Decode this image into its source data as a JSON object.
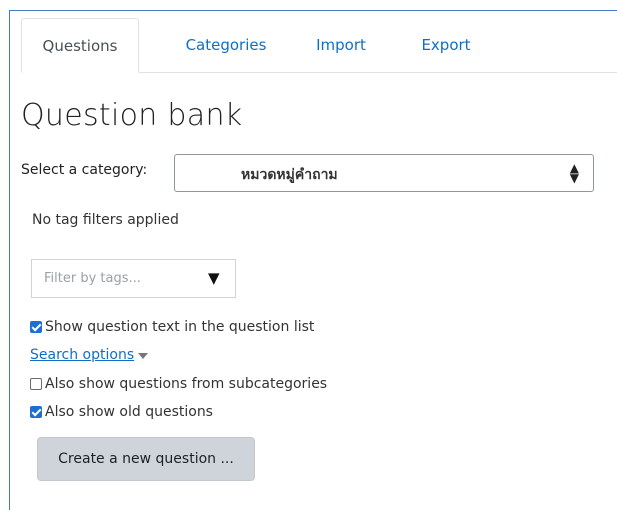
{
  "tabs": [
    {
      "label": "Questions",
      "active": true
    },
    {
      "label": "Categories",
      "active": false
    },
    {
      "label": "Import",
      "active": false
    },
    {
      "label": "Export",
      "active": false
    }
  ],
  "page_title": "Question bank",
  "category": {
    "label": "Select a category:",
    "selected": "หมวดหมู่คำถาม"
  },
  "tag_filter": {
    "status": "No tag filters applied",
    "placeholder": "Filter by tags...",
    "dropdown_glyph": "▼"
  },
  "options": {
    "show_question_text": {
      "label": "Show question text in the question list",
      "checked": true
    },
    "search_options_link": "Search options",
    "subcategories": {
      "label": "Also show questions from subcategories",
      "checked": false
    },
    "old_questions": {
      "label": "Also show old questions",
      "checked": true
    }
  },
  "create_button": "Create a new question ...",
  "colors": {
    "link": "#0f6fc5",
    "checkbox": "#1f6fd2",
    "button_bg": "#ced4da",
    "frame_border": "#4a78c0"
  }
}
